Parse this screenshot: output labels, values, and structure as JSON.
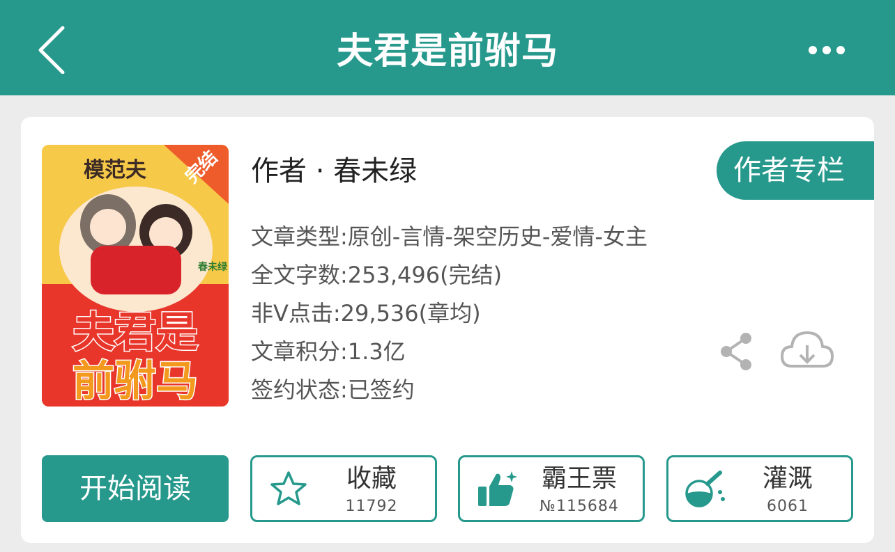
{
  "header": {
    "title": "夫君是前驸马"
  },
  "cover": {
    "banner": "完结",
    "series": "模范夫",
    "title_lines": [
      "夫君是",
      "前驸马"
    ],
    "author_stamp": "春未绿"
  },
  "book": {
    "author": "作者 · 春未绿",
    "author_column": "作者专栏",
    "info": [
      "文章类型:原创-言情-架空历史-爱情-女主",
      "全文字数:253,496(完结)",
      "非V点击:29,536(章均)",
      "文章积分:1.3亿",
      "签约状态:已签约"
    ]
  },
  "actions": {
    "read": "开始阅读",
    "favorite": {
      "label": "收藏",
      "count": "11792"
    },
    "vote": {
      "label": "霸王票",
      "count": "№115684"
    },
    "water": {
      "label": "灌溉",
      "count": "6061"
    }
  },
  "colors": {
    "accent": "#26998c",
    "text": "#555555"
  },
  "icons": [
    "back-arrow-icon",
    "more-dots-icon",
    "share-icon",
    "download-cloud-icon",
    "star-icon",
    "thumbs-up-icon",
    "watering-flask-icon"
  ]
}
